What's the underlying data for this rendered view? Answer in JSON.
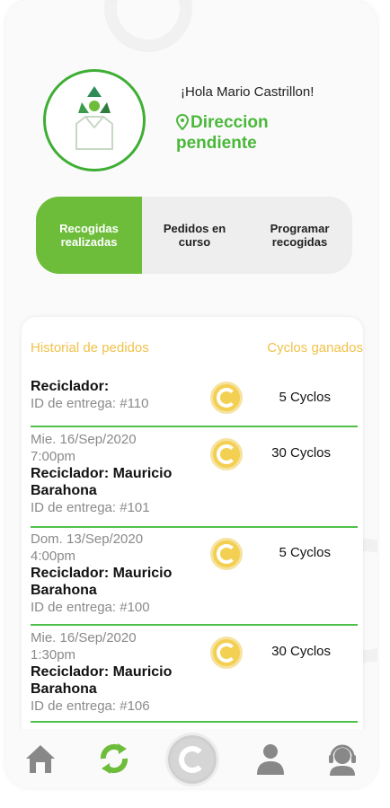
{
  "user": {
    "greeting": "¡Hola Mario Castrillon!",
    "address_status": "Direccion pendiente"
  },
  "tabs": [
    {
      "label": "Recogidas realizadas",
      "active": true
    },
    {
      "label": "Pedidos en curso",
      "active": false
    },
    {
      "label": "Programar recogidas",
      "active": false
    }
  ],
  "history": {
    "left_header": "Historial de pedidos",
    "right_header": "Cyclos ganados",
    "orders": [
      {
        "date": "",
        "time": "",
        "recycler": "Reciclador:",
        "delivery_id": "ID de entrega: #110",
        "cyclos": "5 Cyclos"
      },
      {
        "date": "Mie. 16/Sep/2020",
        "time": "7:00pm",
        "recycler": "Reciclador: Mauricio Barahona",
        "delivery_id": "ID de entrega: #101",
        "cyclos": "30 Cyclos"
      },
      {
        "date": "Dom. 13/Sep/2020",
        "time": "4:00pm",
        "recycler": "Reciclador: Mauricio Barahona",
        "delivery_id": "ID de entrega: #100",
        "cyclos": "5 Cyclos"
      },
      {
        "date": "Mie. 16/Sep/2020",
        "time": "1:30pm",
        "recycler": "Reciclador: Mauricio Barahona",
        "delivery_id": "ID de entrega: #106",
        "cyclos": "30 Cyclos"
      }
    ]
  },
  "nav": {
    "items": [
      "home-icon",
      "recycle-icon",
      "cyclos-coin-icon",
      "profile-icon",
      "support-icon"
    ]
  },
  "colors": {
    "accent_green": "#6dbd3b",
    "coin_yellow": "#f3cf52",
    "header_gold": "#f0c24a"
  }
}
